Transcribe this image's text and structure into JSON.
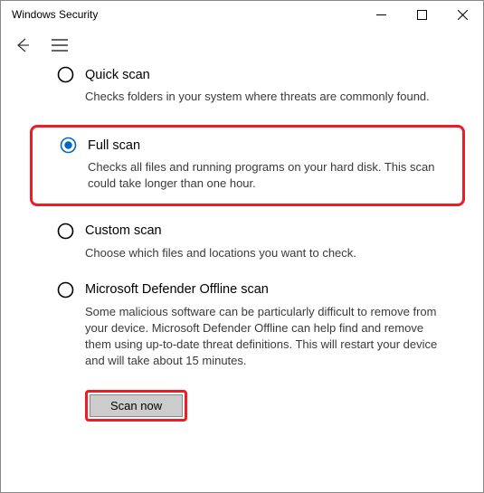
{
  "window": {
    "title": "Windows Security"
  },
  "options": [
    {
      "label": "Quick scan",
      "desc": "Checks folders in your system where threats are commonly found.",
      "selected": false
    },
    {
      "label": "Full scan",
      "desc": "Checks all files and running programs on your hard disk. This scan could take longer than one hour.",
      "selected": true
    },
    {
      "label": "Custom scan",
      "desc": "Choose which files and locations you want to check.",
      "selected": false
    },
    {
      "label": "Microsoft Defender Offline scan",
      "desc": "Some malicious software can be particularly difficult to remove from your device. Microsoft Defender Offline can help find and remove them using up-to-date threat definitions. This will restart your device and will take about 15 minutes.",
      "selected": false
    }
  ],
  "action": {
    "scan_label": "Scan now"
  },
  "highlight": {
    "option_index": 1,
    "action_button": true,
    "color": "#ee1c25"
  }
}
